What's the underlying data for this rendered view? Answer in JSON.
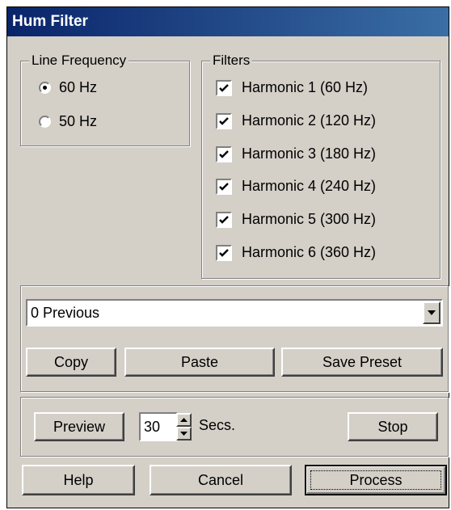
{
  "window": {
    "title": "Hum Filter"
  },
  "line_frequency": {
    "legend": "Line Frequency",
    "options": [
      {
        "label": "60 Hz",
        "selected": true
      },
      {
        "label": "50 Hz",
        "selected": false
      }
    ]
  },
  "filters": {
    "legend": "Filters",
    "items": [
      {
        "label": "Harmonic 1 (60 Hz)",
        "checked": true
      },
      {
        "label": "Harmonic 2 (120 Hz)",
        "checked": true
      },
      {
        "label": "Harmonic 3 (180 Hz)",
        "checked": true
      },
      {
        "label": "Harmonic 4 (240 Hz)",
        "checked": true
      },
      {
        "label": "Harmonic 5 (300 Hz)",
        "checked": true
      },
      {
        "label": "Harmonic 6 (360 Hz)",
        "checked": true
      }
    ]
  },
  "presets": {
    "selected": "0 Previous",
    "copy_label": "Copy",
    "paste_label": "Paste",
    "save_label": "Save Preset"
  },
  "preview": {
    "preview_label": "Preview",
    "seconds_value": "30",
    "seconds_unit": "Secs.",
    "stop_label": "Stop"
  },
  "footer": {
    "help_label": "Help",
    "cancel_label": "Cancel",
    "process_label": "Process"
  },
  "icons": {
    "combo_arrow": "chevron-down-icon",
    "spin_up": "arrow-up-icon",
    "spin_down": "arrow-down-icon",
    "check": "checkmark-icon"
  }
}
